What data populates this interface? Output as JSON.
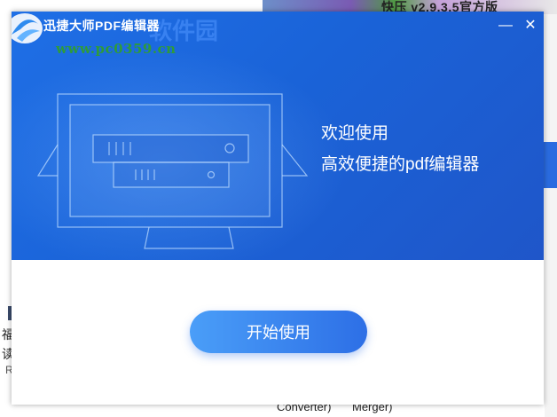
{
  "background": {
    "top_banner_text": "快压 v2.9.3.5官方版",
    "left_fragments": [
      "福",
      "读",
      "Ri"
    ],
    "bottom_fragments": [
      "Converter)",
      "Merger)"
    ]
  },
  "dialog": {
    "title": "迅捷大师PDF编辑器",
    "watermark_url": "www.pc0359.cn",
    "watermark_mark": "软件园",
    "minimize_label": "—",
    "close_label": "✕",
    "welcome_line1": "欢迎使用",
    "welcome_line2": "高效便捷的pdf编辑器",
    "start_button_label": "开始使用"
  },
  "icons": {
    "logo": "app-logo-icon",
    "illustration": "monitor-device-illustration"
  },
  "colors": {
    "banner": "#1f63d8",
    "button_start": "#4a9ef8",
    "button_end": "#2d6fe6",
    "watermark_green": "#2e9b3a"
  }
}
